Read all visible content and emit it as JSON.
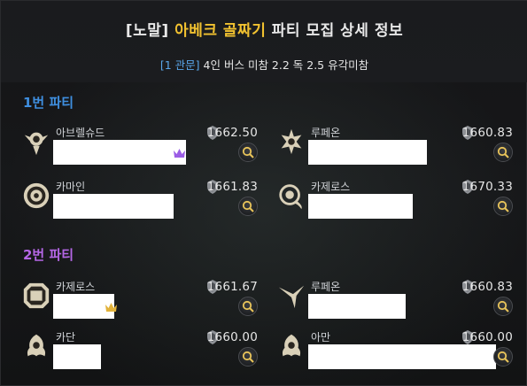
{
  "header": {
    "title_prefix": "[노말]",
    "title_highlight": "아베크 골짜기",
    "title_suffix": "파티 모집 상세 정보",
    "subtitle_tag": "[1 관문]",
    "subtitle_text": "4인 버스 미참 2.2 독 2.5 유각미참"
  },
  "colors": {
    "party1": "#3f8fe0",
    "party2": "#b567e6",
    "highlight": "#f2c230",
    "crown_purple": "#9b5de5",
    "crown_gold": "#e2b23a"
  },
  "parties": [
    {
      "label": "1번 파티",
      "members": [
        {
          "class": "아브렐슈드",
          "item_level": "1662.50",
          "icon": "bard-emblem-icon",
          "leader": true
        },
        {
          "class": "루페온",
          "item_level": "1660.83",
          "icon": "holyknight-emblem-icon",
          "leader": false
        },
        {
          "class": "카마인",
          "item_level": "1661.83",
          "icon": "arcana-emblem-icon",
          "leader": false
        },
        {
          "class": "카제로스",
          "item_level": "1670.33",
          "icon": "reaper-emblem-icon",
          "leader": false
        }
      ]
    },
    {
      "label": "2번 파티",
      "members": [
        {
          "class": "카제로스",
          "item_level": "1661.67",
          "icon": "gunlancer-emblem-icon",
          "leader": true
        },
        {
          "class": "루페온",
          "item_level": "1660.83",
          "icon": "berserker-emblem-icon",
          "leader": false
        },
        {
          "class": "카단",
          "item_level": "1660.00",
          "icon": "fighter-emblem-icon",
          "leader": false
        },
        {
          "class": "아만",
          "item_level": "1660.00",
          "icon": "fighter-emblem-icon",
          "leader": false
        }
      ]
    }
  ]
}
